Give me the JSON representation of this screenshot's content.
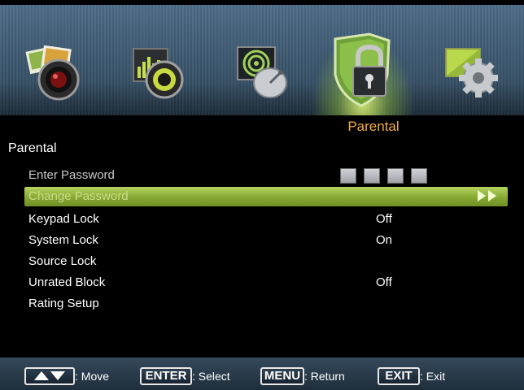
{
  "tabs": [
    {
      "name": "picture",
      "icon": "camera-photos-icon",
      "selected": false
    },
    {
      "name": "sound",
      "icon": "speaker-equalizer-icon",
      "selected": false
    },
    {
      "name": "channel",
      "icon": "satellite-dish-icon",
      "selected": false
    },
    {
      "name": "parental",
      "icon": "shield-padlock-icon",
      "selected": true
    },
    {
      "name": "setup",
      "icon": "gear-monitor-icon",
      "selected": false
    }
  ],
  "section_title": "Parental",
  "menu_title": "Parental",
  "menu": {
    "enter_password": {
      "label": "Enter Password",
      "value_icon": "password-boxes-icon",
      "digits": 4
    },
    "change_password": {
      "label": "Change Password",
      "selected": true,
      "value_icon": "double-arrow-right-icon"
    },
    "keypad_lock": {
      "label": "Keypad Lock",
      "value": "Off"
    },
    "system_lock": {
      "label": "System Lock",
      "value": "On"
    },
    "source_lock": {
      "label": "Source Lock",
      "value": ""
    },
    "unrated_block": {
      "label": "Unrated Block",
      "value": "Off"
    },
    "rating_setup": {
      "label": "Rating Setup",
      "value": ""
    }
  },
  "footer": {
    "move": {
      "key_icon": "up-down-arrows-icon",
      "desc": ": Move"
    },
    "select": {
      "key": "ENTER",
      "desc": ": Select"
    },
    "return": {
      "key": "MENU",
      "desc": ": Return"
    },
    "exit": {
      "key": "EXIT",
      "desc": ": Exit"
    }
  },
  "colors": {
    "accent_orange": "#f2ad3d",
    "highlight_green": "#8fb23c",
    "tabbar_blue": "#3c5870",
    "background": "#000000"
  }
}
